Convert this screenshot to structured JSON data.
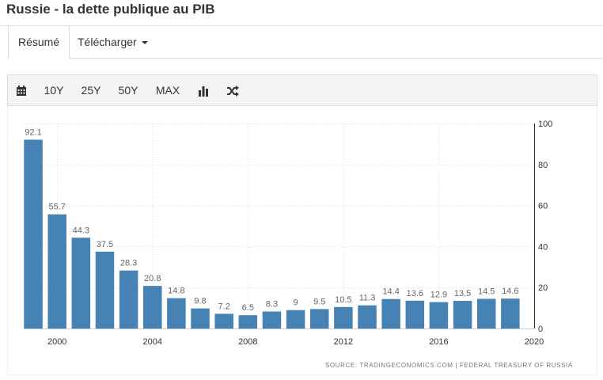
{
  "page": {
    "title": "Russie - la dette publique au PIB"
  },
  "tabs": [
    {
      "label": "Résumé",
      "active": true
    },
    {
      "label": "Télécharger",
      "active": false
    }
  ],
  "toolbar": {
    "items": [
      {
        "name": "calendar-icon",
        "label": ""
      },
      {
        "name": "range-10y",
        "label": "10Y"
      },
      {
        "name": "range-25y",
        "label": "25Y"
      },
      {
        "name": "range-50y",
        "label": "50Y"
      },
      {
        "name": "range-max",
        "label": "MAX"
      },
      {
        "name": "bar-chart-icon",
        "label": ""
      },
      {
        "name": "shuffle-icon",
        "label": ""
      }
    ]
  },
  "source": "SOURCE: TRADINGECONOMICS.COM | FEDERAL TREASURY OF RUSSIA",
  "colors": {
    "bar": "#4682b4",
    "grid": "#dddddd",
    "label": "#666666"
  },
  "chart_data": {
    "type": "bar",
    "x": [
      1999,
      2000,
      2001,
      2002,
      2003,
      2004,
      2005,
      2006,
      2007,
      2008,
      2009,
      2010,
      2011,
      2012,
      2013,
      2014,
      2015,
      2016,
      2017,
      2018,
      2019
    ],
    "values": [
      92.1,
      55.7,
      44.3,
      37.5,
      28.3,
      20.8,
      14.8,
      9.8,
      7.2,
      6.5,
      8.3,
      9,
      9.5,
      10.5,
      11.3,
      14.4,
      13.6,
      12.9,
      13.5,
      14.5,
      14.6
    ],
    "data_labels": [
      "92.1",
      "55.7",
      "44.3",
      "37.5",
      "28.3",
      "20.8",
      "14.8",
      "9.8",
      "7.2",
      "6.5",
      "8.3",
      "9",
      "9.5",
      "10.5",
      "11.3",
      "14.4",
      "13.6",
      "12.9",
      "13.5",
      "14.5",
      "14.6"
    ],
    "x_ticks": [
      2000,
      2004,
      2008,
      2012,
      2016,
      2020
    ],
    "x_tick_labels": [
      "2000",
      "2004",
      "2008",
      "2012",
      "2016",
      "2020"
    ],
    "y_ticks": [
      0,
      20,
      40,
      60,
      80,
      100
    ],
    "y_tick_labels": [
      "0",
      "20",
      "40",
      "60",
      "80",
      "100"
    ],
    "ylim": [
      0,
      100
    ],
    "xlim": [
      1998.6,
      2020
    ],
    "y_axis_side": "right",
    "grid": true,
    "title": "",
    "xlabel": "",
    "ylabel": ""
  }
}
